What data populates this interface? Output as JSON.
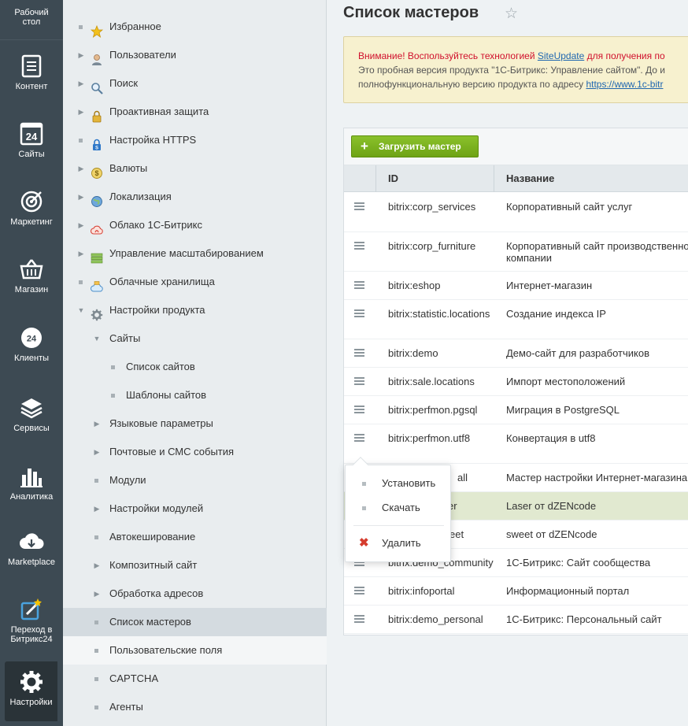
{
  "rail": {
    "items": [
      {
        "label": "Рабочий стол",
        "icon": "desktop-icon"
      },
      {
        "label": "Контент",
        "icon": "content-icon"
      },
      {
        "label": "Сайты",
        "icon": "sites-icon"
      },
      {
        "label": "Маркетинг",
        "icon": "marketing-icon"
      },
      {
        "label": "Магазин",
        "icon": "shop-icon"
      },
      {
        "label": "Клиенты",
        "icon": "clients-icon"
      },
      {
        "label": "Сервисы",
        "icon": "services-icon"
      },
      {
        "label": "Аналитика",
        "icon": "analytics-icon"
      },
      {
        "label": "Marketplace",
        "icon": "marketplace-icon"
      },
      {
        "label": "Переход в Битрикс24",
        "icon": "bitrix24-icon"
      },
      {
        "label": "Настройки",
        "icon": "settings-icon"
      }
    ],
    "sites_badge": "24",
    "clients_badge": "24"
  },
  "menu": {
    "items": [
      {
        "label": "Избранное",
        "icon": "star-icon",
        "marker": "dot"
      },
      {
        "label": "Пользователи",
        "icon": "user-icon",
        "marker": "arrow"
      },
      {
        "label": "Поиск",
        "icon": "search-icon",
        "marker": "arrow"
      },
      {
        "label": "Проактивная защита",
        "icon": "lock-icon",
        "marker": "arrow"
      },
      {
        "label": "Настройка HTTPS",
        "icon": "https-lock-icon",
        "marker": "dot"
      },
      {
        "label": "Валюты",
        "icon": "currency-icon",
        "marker": "arrow"
      },
      {
        "label": "Локализация",
        "icon": "globe-icon",
        "marker": "arrow"
      },
      {
        "label": "Облако 1С-Битрикс",
        "icon": "cloud-bitrix-icon",
        "marker": "arrow"
      },
      {
        "label": "Управление масштабированием",
        "icon": "scale-icon",
        "marker": "arrow"
      },
      {
        "label": "Облачные хранилища",
        "icon": "cloud-storage-icon",
        "marker": "dot"
      },
      {
        "label": "Настройки продукта",
        "icon": "gear-icon",
        "marker": "open"
      },
      {
        "label": "Сайты",
        "marker": "open"
      },
      {
        "label": "Список сайтов",
        "marker": "dot"
      },
      {
        "label": "Шаблоны сайтов",
        "marker": "dot"
      },
      {
        "label": "Языковые параметры",
        "marker": "arrow"
      },
      {
        "label": "Почтовые и СМС события",
        "marker": "arrow"
      },
      {
        "label": "Модули",
        "marker": "dot"
      },
      {
        "label": "Настройки модулей",
        "marker": "arrow"
      },
      {
        "label": "Автокеширование",
        "marker": "dot"
      },
      {
        "label": "Композитный сайт",
        "marker": "arrow"
      },
      {
        "label": "Обработка адресов",
        "marker": "arrow"
      },
      {
        "label": "Список мастеров",
        "marker": "dot"
      },
      {
        "label": "Пользовательские поля",
        "marker": "dot"
      },
      {
        "label": "CAPTCHA",
        "marker": "dot"
      },
      {
        "label": "Агенты",
        "marker": "dot"
      }
    ]
  },
  "page": {
    "title": "Список мастеров"
  },
  "notice": {
    "line1_red": "Внимание! Воспользуйтесь технологией",
    "line1_link": "SiteUpdate",
    "line1_rest": "для получения по",
    "line2": "Это пробная версия продукта \"1С-Битрикс: Управление сайтом\". До и",
    "line3": "полнофункциональную версию продукта по адресу",
    "line3_link": "https://www.1c-bitr"
  },
  "toolbar": {
    "upload_label": "Загрузить мастер"
  },
  "grid": {
    "columns": [
      "ID",
      "Название"
    ],
    "rows": [
      {
        "id": "bitrix:corp_services",
        "name": "Корпоративный сайт услуг"
      },
      {
        "id": "bitrix:corp_furniture",
        "name": "Корпоративный сайт производственно",
        "name2": "компании"
      },
      {
        "id": "bitrix:eshop",
        "name": "Интернет-магазин"
      },
      {
        "id": "bitrix:statistic.locations",
        "name": "Создание индекса IP"
      },
      {
        "id": "bitrix:demo",
        "name": "Демо-сайт для разработчиков"
      },
      {
        "id": "bitrix:sale.locations",
        "name": "Импорт местоположений"
      },
      {
        "id": "bitrix:perfmon.pgsql",
        "name": "Миграция в PostgreSQL"
      },
      {
        "id": "bitrix:perfmon.utf8",
        "name": "Конвертация в utf8"
      },
      {
        "id": "all",
        "name": "Мастер настройки Интернет-магазина"
      },
      {
        "id": "er",
        "name": "Laser от dZENcode"
      },
      {
        "id": "eet",
        "name": "sweet от dZENcode"
      },
      {
        "id": "bitrix:demo_community",
        "name": "1С-Битрикс: Сайт сообщества"
      },
      {
        "id": "bitrix:infoportal",
        "name": "Информационный портал"
      },
      {
        "id": "bitrix:demo_personal",
        "name": "1С-Битрикс: Персональный сайт"
      }
    ]
  },
  "popup": {
    "items": [
      "Установить",
      "Скачать",
      "Удалить"
    ]
  }
}
